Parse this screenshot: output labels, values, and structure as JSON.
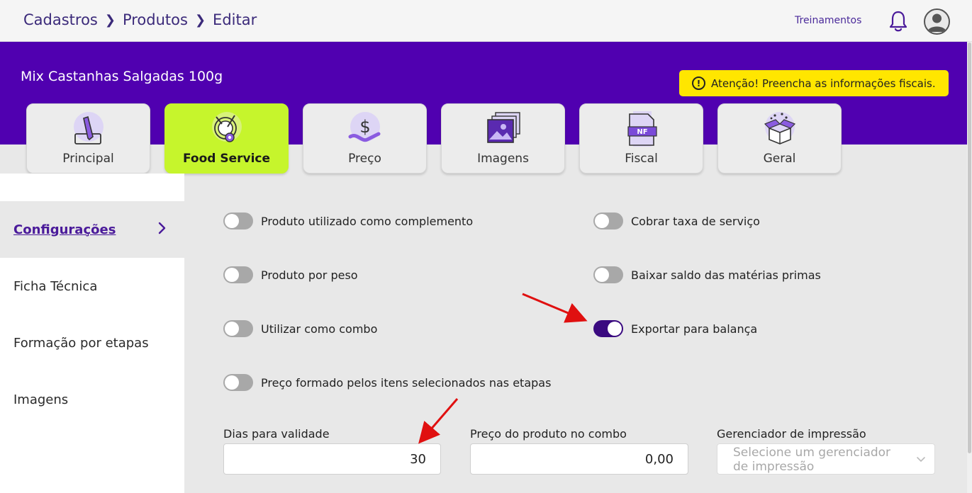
{
  "breadcrumb": [
    "Cadastros",
    "Produtos",
    "Editar"
  ],
  "header": {
    "trainings_link": "Treinamentos",
    "product_title": "Mix Castanhas Salgadas 100g",
    "warning_text": "Atenção! Preencha as informações fiscais.",
    "warning_icon": "!"
  },
  "tabs": [
    {
      "label": "Principal",
      "icon": "pencil-icon",
      "active": false
    },
    {
      "label": "Food Service",
      "icon": "dish-gear-icon",
      "active": true
    },
    {
      "label": "Preço",
      "icon": "dollar-hand-icon",
      "active": false
    },
    {
      "label": "Imagens",
      "icon": "images-icon",
      "active": false
    },
    {
      "label": "Fiscal",
      "icon": "nf-document-icon",
      "active": false
    },
    {
      "label": "Geral",
      "icon": "gift-box-icon",
      "active": false
    }
  ],
  "nf_badge": "NF",
  "sidebar": {
    "items": [
      {
        "label": "Configurações",
        "active": true
      },
      {
        "label": "Ficha Técnica",
        "active": false
      },
      {
        "label": "Formação por etapas",
        "active": false
      },
      {
        "label": "Imagens",
        "active": false
      }
    ]
  },
  "toggles": [
    {
      "label": "Produto utilizado como complemento",
      "on": false
    },
    {
      "label": "Cobrar taxa de serviço",
      "on": false
    },
    {
      "label": "Produto por peso",
      "on": false
    },
    {
      "label": "Baixar saldo das matérias primas",
      "on": false
    },
    {
      "label": "Utilizar como combo",
      "on": false
    },
    {
      "label": "Exportar para balança",
      "on": true
    },
    {
      "label": "Preço formado pelos itens selecionados nas etapas",
      "on": false
    }
  ],
  "fields": {
    "validity_label": "Dias para validade",
    "validity_value": "30",
    "combo_price_label": "Preço do produto no combo",
    "combo_price_value": "0,00",
    "print_manager_label": "Gerenciador de impressão",
    "print_manager_placeholder": "Selecione um gerenciador de impressão"
  },
  "colors": {
    "brand_purple": "#5000b0",
    "active_tab": "#c6f52c",
    "warning_yellow": "#ffe600",
    "toggle_on": "#3a0a80",
    "annotation_arrow": "#e01010"
  }
}
